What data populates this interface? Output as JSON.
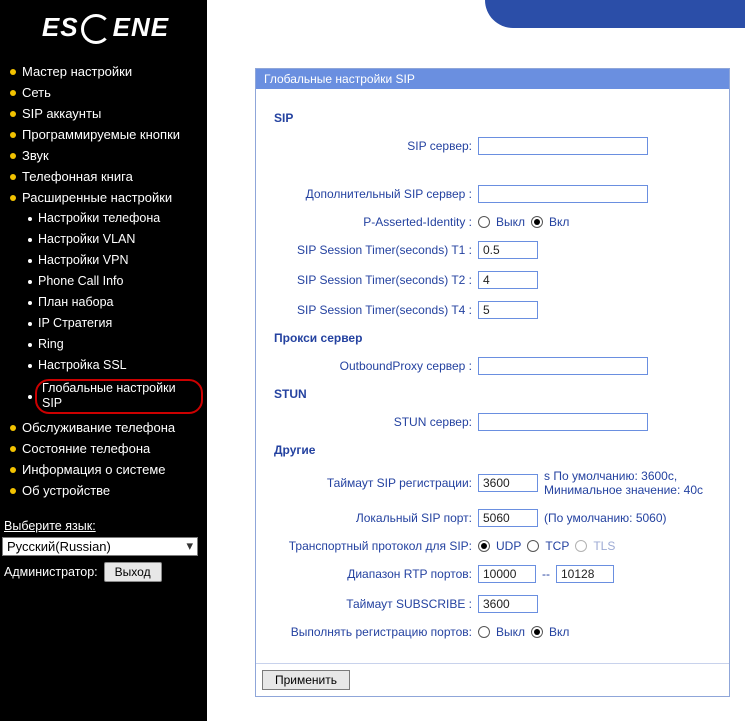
{
  "brand": "ESCENE",
  "sidebar": {
    "items": [
      {
        "label": "Мастер настройки"
      },
      {
        "label": "Сеть"
      },
      {
        "label": "SIP аккаунты"
      },
      {
        "label": "Программируемые кнопки"
      },
      {
        "label": "Звук"
      },
      {
        "label": "Телефонная книга"
      },
      {
        "label": "Расширенные настройки",
        "expanded": true,
        "children": [
          {
            "label": "Настройки телефона"
          },
          {
            "label": "Настройки VLAN"
          },
          {
            "label": "Настройки VPN"
          },
          {
            "label": "Phone Call Info"
          },
          {
            "label": "План набора"
          },
          {
            "label": "IP Стратегия"
          },
          {
            "label": "Ring"
          },
          {
            "label": "Настройка SSL"
          },
          {
            "label": "Глобальные настройки SIP",
            "current": true
          }
        ]
      },
      {
        "label": "Обслуживание телефона"
      },
      {
        "label": "Состояние телефона"
      },
      {
        "label": "Информация о системе"
      },
      {
        "label": "Об устройстве"
      }
    ],
    "language_label": "Выберите язык:",
    "language_value": "Русский(Russian)",
    "admin_label": "Администратор:",
    "logout_label": "Выход"
  },
  "panel": {
    "title": "Глобальные настройки SIP",
    "sections": {
      "sip_title": "SIP",
      "proxy_title": "Прокси сервер",
      "stun_title": "STUN",
      "other_title": "Другие"
    },
    "labels": {
      "sip_server": "SIP сервер:",
      "alt_sip_server": "Дополнительный SIP сервер :",
      "p_asserted": "P-Asserted-Identity :",
      "t1": "SIP Session Timer(seconds) T1 :",
      "t2": "SIP Session Timer(seconds) T2 :",
      "t4": "SIP Session Timer(seconds) T4 :",
      "outbound": "OutboundProxy сервер :",
      "stun_server": "STUN сервер:",
      "reg_timeout": "Таймаут SIP регистрации:",
      "local_port": "Локальный SIP порт:",
      "transport": "Транспортный протокол для SIP:",
      "rtp_range": "Диапазон RTP портов:",
      "subscribe_timeout": "Таймаут SUBSCRIBE :",
      "port_reg": "Выполнять регистрацию портов:",
      "off": "Выкл",
      "on": "Вкл",
      "udp": "UDP",
      "tcp": "TCP",
      "tls": "TLS",
      "range_sep": "--"
    },
    "values": {
      "sip_server": "",
      "alt_sip_server": "",
      "p_asserted": "on",
      "t1": "0.5",
      "t2": "4",
      "t4": "5",
      "outbound": "",
      "stun_server": "",
      "reg_timeout": "3600",
      "local_port": "5060",
      "transport": "udp",
      "rtp_from": "10000",
      "rtp_to": "10128",
      "subscribe_timeout": "3600",
      "port_reg": "on"
    },
    "hints": {
      "reg_timeout": "s По умолчанию: 3600с, Минимальное значение: 40с",
      "local_port": "(По умолчанию: 5060)"
    },
    "apply_label": "Применить"
  }
}
